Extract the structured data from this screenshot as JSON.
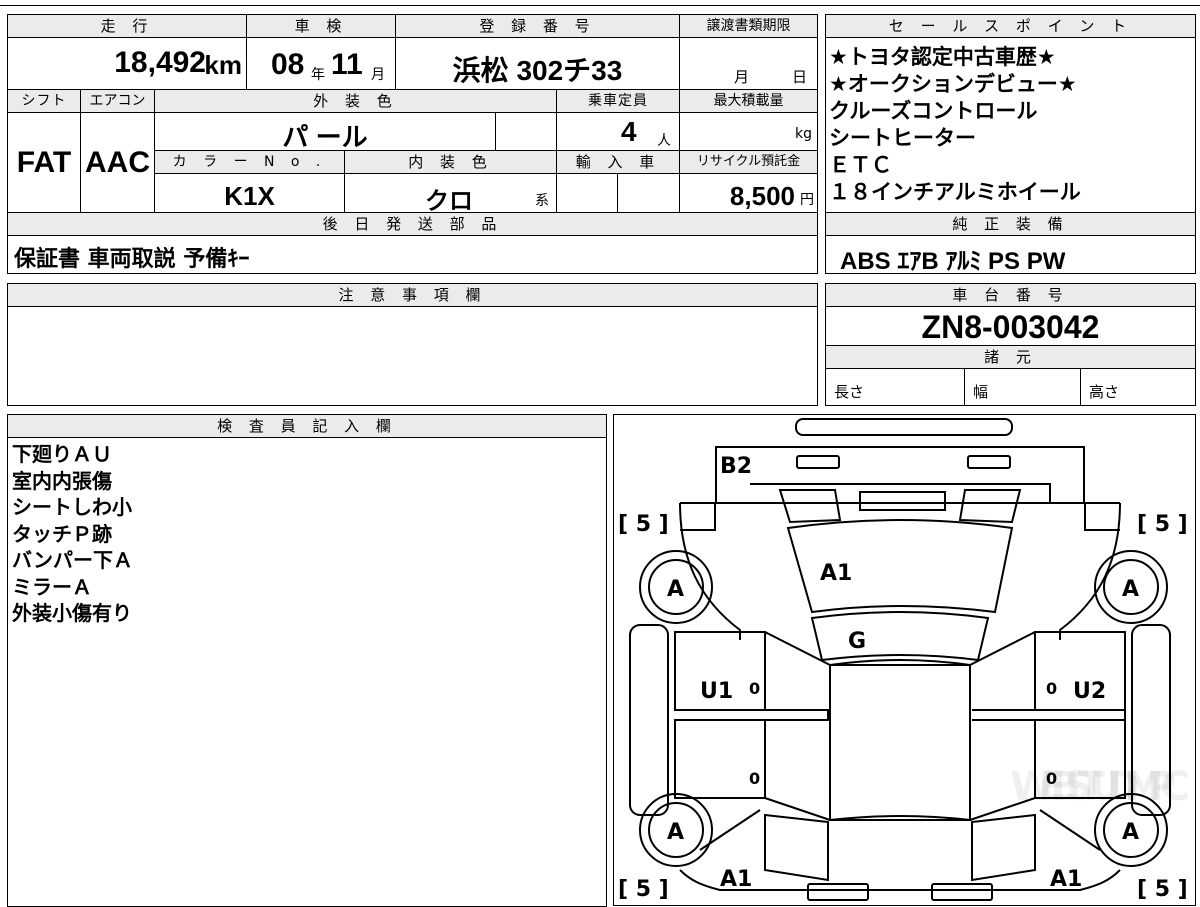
{
  "vehicle": {
    "headers": {
      "mileage": "走 行",
      "inspection": "車 検",
      "registration": "登 録 番 号",
      "transfer_deadline": "譲渡書類期限"
    },
    "mileage_value": "18,492",
    "mileage_unit": "km",
    "inspection_year": "08",
    "year_unit": "年",
    "inspection_month": "11",
    "month_unit": "月",
    "registration_number": "浜松 302チ33",
    "deadline_month_unit": "月",
    "deadline_day_unit": "日"
  },
  "specs": {
    "headers": {
      "shift": "シフト",
      "aircon": "エアコン",
      "exterior_color": "外 装 色",
      "capacity": "乗車定員",
      "max_load": "最大積載量",
      "color_no": "カ ラ ー N o .",
      "interior_color": "内 装 色",
      "import": "輸 入 車",
      "recycle": "リサイクル預託金"
    },
    "shift": "FAT",
    "aircon": "AAC",
    "exterior_color": "パ ール",
    "capacity": "4",
    "capacity_unit": "人",
    "load_unit": "kg",
    "color_no": "K1X",
    "interior_color": "クロ",
    "interior_suffix": "系",
    "recycle_fee": "8,500",
    "recycle_unit": "円"
  },
  "later_shipping": {
    "header": "後 日 発 送 部 品",
    "value": "保証書 車両取説 予備ｷｰ"
  },
  "sales_points": {
    "header": "セ ー ル ス ポ イ ン ト",
    "items": [
      "★トヨタ認定中古車歴★",
      "★オークションデビュー★",
      "クルーズコントロール",
      "シートヒーター",
      "ＥＴＣ",
      "１８インチアルミホイール"
    ]
  },
  "genuine_equipment": {
    "header": "純 正 装 備",
    "value": "ABS ｴｱB ｱﾙﾐ PS PW"
  },
  "notes": {
    "header": "注 意 事 項 欄"
  },
  "chassis": {
    "header": "車 台 番 号",
    "value": "ZN8-003042"
  },
  "dimensions": {
    "header": "諸 元",
    "length": "長さ",
    "width": "幅",
    "height": "高さ"
  },
  "inspector": {
    "header": "検 査 員 記 入 欄",
    "lines": [
      "下廻りＡＵ",
      "室内内張傷",
      "シートしわ小",
      "タッチＰ跡",
      "バンパー下Ａ",
      "ミラーＡ",
      "外装小傷有り"
    ]
  },
  "diagram": {
    "tire_brackets": "[ 5 ]",
    "wheel_grade": "A",
    "marks": {
      "rear": "B2",
      "hood": "A1",
      "windshield": "G",
      "left_side": "U1",
      "right_side": "U2",
      "front_left": "A1",
      "front_right": "A1"
    },
    "zero": "0"
  },
  "watermark": "WEB STUDIM PC"
}
